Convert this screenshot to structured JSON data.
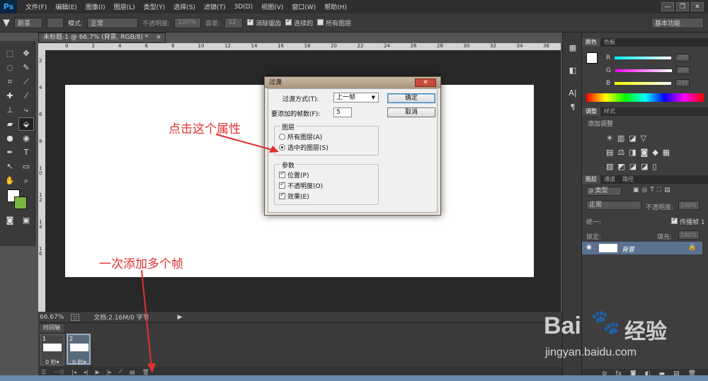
{
  "menubar": {
    "logo": "Ps",
    "items": [
      "文件(F)",
      "编辑(E)",
      "图像(I)",
      "图层(L)",
      "类型(Y)",
      "选择(S)",
      "滤镜(T)",
      "3D(D)",
      "视图(V)",
      "窗口(W)",
      "帮助(H)"
    ],
    "window_buttons": [
      "—",
      "❐",
      "✕"
    ]
  },
  "options": {
    "fill_source": "前景",
    "mode_label": "模式:",
    "mode_value": "正常",
    "opacity_label": "不透明度:",
    "opacity_value": "100%",
    "tolerance_label": "容差:",
    "tolerance_value": "32",
    "antialias_label": "消除锯齿",
    "contiguous_label": "连续的",
    "all_layers_label": "所有图层",
    "workspace": "基本功能"
  },
  "document": {
    "tab_title": "未标题-1 @ 66.7% (背景, RGB/8) *",
    "zoom": "66.67%",
    "doc_info": "文档:2.16M/0 字节",
    "ruler_h": [
      "0",
      "2",
      "4",
      "6",
      "8",
      "10",
      "12",
      "14",
      "16",
      "18",
      "20",
      "22",
      "24",
      "26",
      "28",
      "30",
      "32",
      "34",
      "36"
    ],
    "ruler_v": [
      "2",
      "4",
      "6",
      "8",
      "1 0",
      "1 2",
      "1 4",
      "1 6"
    ]
  },
  "timeline": {
    "tab": "时间轴",
    "frames": [
      {
        "num": "1",
        "duration": "0 秒▾"
      },
      {
        "num": "2",
        "duration": "0 秒▾"
      }
    ],
    "loop": "一次"
  },
  "dialog": {
    "title": "过渡",
    "transition_label": "过渡方式(T):",
    "transition_value": "上一帧",
    "frames_label": "要添加的帧数(F):",
    "frames_value": "5",
    "ok": "确定",
    "cancel": "取消",
    "layers_group": "图层",
    "all_layers": "所有图层(A)",
    "selected_layers": "选中的图层(S)",
    "params_group": "参数",
    "position": "位置(P)",
    "opacity": "不透明度(O)",
    "effects": "效果(E)"
  },
  "annotations": {
    "click_property": "点击这个属性",
    "add_frames": "一次添加多个帧"
  },
  "color_panel": {
    "tabs": [
      "颜色",
      "色板"
    ],
    "channels": [
      {
        "label": "R",
        "value": "255"
      },
      {
        "label": "G",
        "value": "255"
      },
      {
        "label": "B",
        "value": "255"
      }
    ]
  },
  "adjust_panel": {
    "tabs": [
      "调整",
      "样式"
    ],
    "add_label": "添加调整"
  },
  "layers_panel": {
    "tabs": [
      "图层",
      "通道",
      "路径"
    ],
    "filter": "ρ 类型",
    "blend": "正常",
    "opacity_label": "不透明度:",
    "opacity_value": "100%",
    "unify_label": "统一:",
    "propagate_label": "传播帧 1",
    "lock_label": "锁定:",
    "fill_label": "填充:",
    "fill_value": "100%",
    "layer_name": "背景"
  },
  "watermark": {
    "brand": "Bai",
    "brand2": "经验",
    "url": "jingyan.baidu.com"
  }
}
